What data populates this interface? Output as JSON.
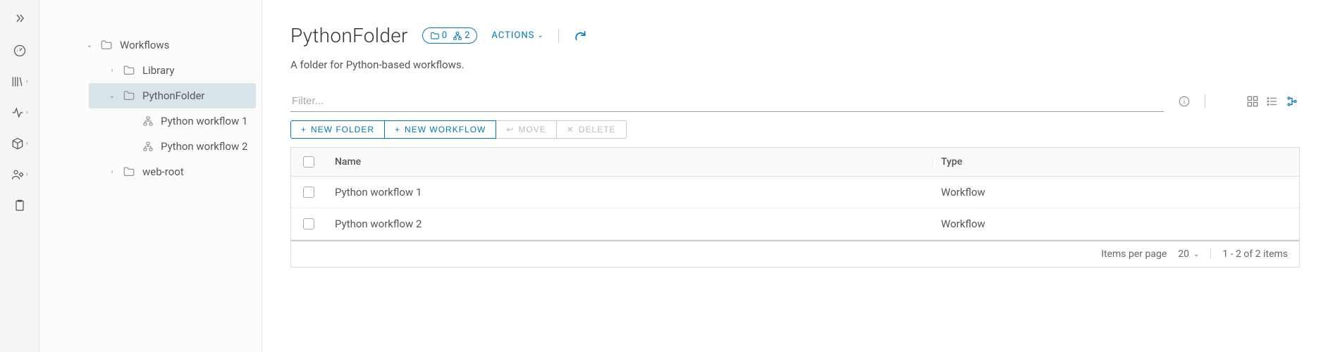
{
  "rail": {
    "items": [
      "dashboard",
      "library",
      "activity",
      "packages",
      "admin",
      "inventory"
    ]
  },
  "tree": {
    "root": "Workflows",
    "nodes": [
      {
        "label": "Library",
        "expanded": false,
        "icon": "folder",
        "selected": false,
        "indent": 1
      },
      {
        "label": "PythonFolder",
        "expanded": true,
        "icon": "folder",
        "selected": true,
        "indent": 1
      },
      {
        "label": "Python workflow 1",
        "expanded": null,
        "icon": "workflow",
        "selected": false,
        "indent": 2
      },
      {
        "label": "Python workflow 2",
        "expanded": null,
        "icon": "workflow",
        "selected": false,
        "indent": 2
      },
      {
        "label": "web-root",
        "expanded": false,
        "icon": "folder",
        "selected": false,
        "indent": 1
      }
    ]
  },
  "header": {
    "title": "PythonFolder",
    "badge": {
      "folders": 0,
      "workflows": 2
    },
    "actions_label": "ACTIONS",
    "description": "A folder for Python-based workflows."
  },
  "filter": {
    "placeholder": "Filter..."
  },
  "toolbar": {
    "new_folder": "NEW FOLDER",
    "new_workflow": "NEW WORKFLOW",
    "move": "MOVE",
    "delete": "DELETE"
  },
  "table": {
    "columns": {
      "name": "Name",
      "type": "Type"
    },
    "rows": [
      {
        "name": "Python workflow 1",
        "type": "Workflow"
      },
      {
        "name": "Python workflow 2",
        "type": "Workflow"
      }
    ],
    "footer": {
      "items_per_page_label": "Items per page",
      "page_size": "20",
      "range": "1 - 2 of 2 items"
    }
  }
}
